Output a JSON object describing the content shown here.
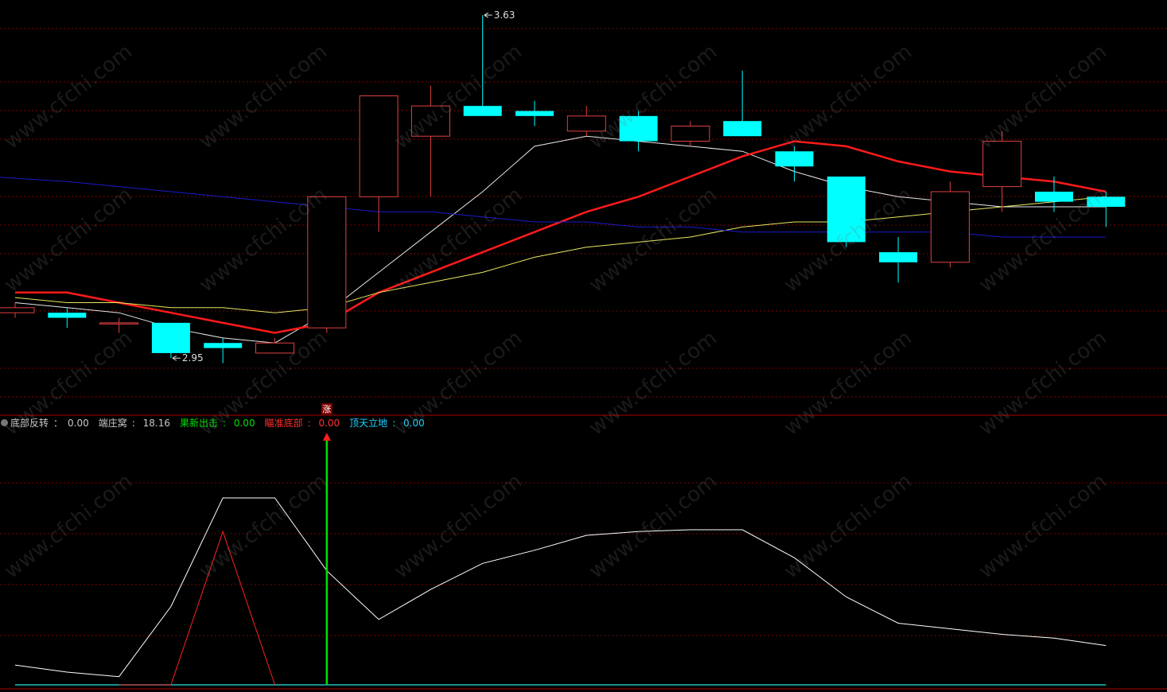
{
  "watermark": "www.cfchi.com",
  "signal_label": "涨",
  "legend": {
    "items": [
      {
        "label": "底部反转",
        "sep": "：",
        "value": "0.00",
        "color": "#c8c8c8"
      },
      {
        "label": "端庄窝",
        "sep": ": ",
        "value": "18.16",
        "color": "#c8c8c8"
      },
      {
        "label": "果新出击",
        "sep": ": ",
        "value": "0.00",
        "color": "#00e000"
      },
      {
        "label": "瞄准底部",
        "sep": ": ",
        "value": "0.00",
        "color": "#ff3030"
      },
      {
        "label": "顶天立地",
        "sep": ": ",
        "value": "0.00",
        "color": "#20d0ff"
      }
    ]
  },
  "colors": {
    "background": "#000000",
    "grid": "#7a0000",
    "up_candle": "#e04040",
    "down_candle": "#00ffff",
    "ma_white": "#e8e8e8",
    "ma_red": "#ff1a1a",
    "ma_yellow": "#e8e860",
    "ma_blue": "#1a1acc",
    "indicator_white": "#ffffff",
    "indicator_red": "#ff2020",
    "signal_green": "#00e000",
    "baseline": "#20c0c0"
  },
  "chart_data": [
    {
      "type": "candlestick",
      "ylim": [
        2.84,
        3.66
      ],
      "annotations": [
        {
          "index": 3,
          "value": 2.95,
          "text": "2.95"
        },
        {
          "index": 9,
          "value": 3.63,
          "text": "3.63"
        }
      ],
      "candles": [
        {
          "o": 3.04,
          "h": 3.06,
          "l": 3.03,
          "c": 3.05
        },
        {
          "o": 3.04,
          "h": 3.05,
          "l": 3.01,
          "c": 3.03
        },
        {
          "o": 3.02,
          "h": 3.03,
          "l": 3.0,
          "c": 3.02
        },
        {
          "o": 3.02,
          "h": 3.02,
          "l": 2.95,
          "c": 2.96
        },
        {
          "o": 2.98,
          "h": 2.99,
          "l": 2.94,
          "c": 2.97
        },
        {
          "o": 2.96,
          "h": 2.99,
          "l": 2.96,
          "c": 2.98
        },
        {
          "o": 3.01,
          "h": 3.27,
          "l": 3.0,
          "c": 3.27
        },
        {
          "o": 3.27,
          "h": 3.47,
          "l": 3.2,
          "c": 3.47
        },
        {
          "o": 3.39,
          "h": 3.49,
          "l": 3.27,
          "c": 3.45
        },
        {
          "o": 3.45,
          "h": 3.63,
          "l": 3.43,
          "c": 3.43
        },
        {
          "o": 3.44,
          "h": 3.46,
          "l": 3.41,
          "c": 3.43
        },
        {
          "o": 3.4,
          "h": 3.45,
          "l": 3.39,
          "c": 3.43
        },
        {
          "o": 3.43,
          "h": 3.44,
          "l": 3.36,
          "c": 3.38
        },
        {
          "o": 3.38,
          "h": 3.42,
          "l": 3.37,
          "c": 3.41
        },
        {
          "o": 3.42,
          "h": 3.52,
          "l": 3.39,
          "c": 3.39
        },
        {
          "o": 3.36,
          "h": 3.37,
          "l": 3.3,
          "c": 3.33
        },
        {
          "o": 3.31,
          "h": 3.31,
          "l": 3.17,
          "c": 3.18
        },
        {
          "o": 3.16,
          "h": 3.19,
          "l": 3.1,
          "c": 3.14
        },
        {
          "o": 3.14,
          "h": 3.3,
          "l": 3.13,
          "c": 3.28
        },
        {
          "o": 3.29,
          "h": 3.4,
          "l": 3.24,
          "c": 3.38
        },
        {
          "o": 3.28,
          "h": 3.31,
          "l": 3.24,
          "c": 3.26
        },
        {
          "o": 3.27,
          "h": 3.28,
          "l": 3.21,
          "c": 3.25
        }
      ],
      "series": [
        {
          "key": "ma_white",
          "values": [
            3.06,
            3.05,
            3.04,
            3.01,
            2.99,
            2.98,
            3.04,
            3.12,
            3.2,
            3.28,
            3.37,
            3.39,
            3.38,
            3.37,
            3.36,
            3.32,
            3.29,
            3.27,
            3.26,
            3.25,
            3.25,
            3.25
          ]
        },
        {
          "key": "ma_red",
          "values": [
            3.08,
            3.08,
            3.06,
            3.04,
            3.02,
            3.0,
            3.02,
            3.08,
            3.12,
            3.16,
            3.2,
            3.24,
            3.27,
            3.31,
            3.35,
            3.38,
            3.37,
            3.34,
            3.32,
            3.31,
            3.3,
            3.28
          ]
        },
        {
          "key": "ma_yellow",
          "values": [
            3.07,
            3.06,
            3.06,
            3.05,
            3.05,
            3.04,
            3.05,
            3.08,
            3.1,
            3.12,
            3.15,
            3.17,
            3.18,
            3.19,
            3.21,
            3.22,
            3.22,
            3.23,
            3.24,
            3.25,
            3.26,
            3.27
          ]
        },
        {
          "key": "ma_blue",
          "values": [
            3.31,
            3.3,
            3.29,
            3.28,
            3.27,
            3.26,
            3.25,
            3.24,
            3.24,
            3.23,
            3.22,
            3.22,
            3.21,
            3.21,
            3.2,
            3.2,
            3.2,
            3.2,
            3.2,
            3.19,
            3.19,
            3.19
          ],
          "x_start": -0.5
        }
      ]
    },
    {
      "type": "line",
      "ylim": [
        0,
        100
      ],
      "series": [
        {
          "key": "indicator_white",
          "values": [
            10.6,
            6.8,
            4.4,
            41.9,
            100,
            100,
            61,
            35,
            51,
            65,
            72,
            80,
            82,
            83,
            83,
            68,
            47,
            33,
            30,
            27,
            25,
            21
          ]
        },
        {
          "key": "indicator_red",
          "values": [
            null,
            null,
            0,
            0,
            82,
            0,
            null,
            null,
            null,
            null,
            null,
            null,
            null,
            null,
            null,
            null,
            null,
            null,
            null,
            null,
            null,
            null
          ]
        }
      ],
      "signals": [
        {
          "index": 6,
          "type": "buy"
        }
      ],
      "baseline": 0
    }
  ]
}
